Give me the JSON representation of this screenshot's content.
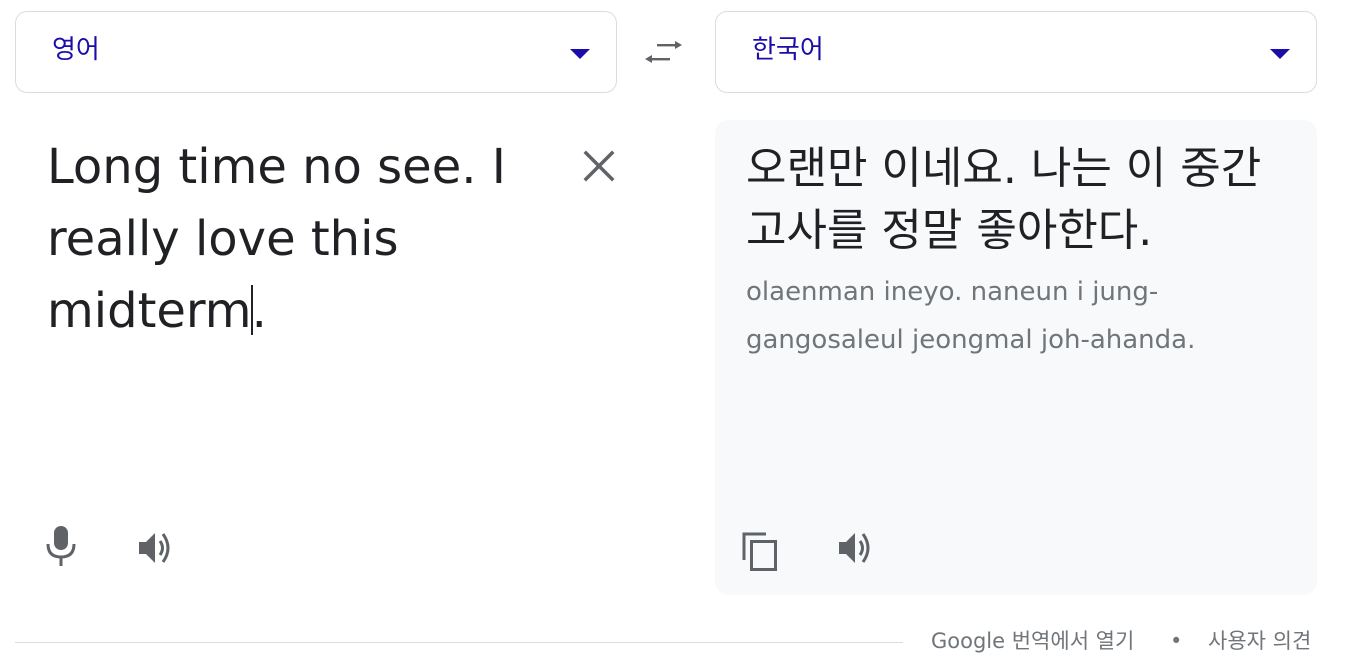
{
  "source": {
    "language": "영어",
    "text_before_cursor": "Long time no see. I really love this midterm",
    "text_after_cursor": "."
  },
  "target": {
    "language": "한국어",
    "translation": "오랜만 이네요. 나는 이 중간 고사를 정말 좋아한다.",
    "romanization": "olaenman ineyo. naneun i jung-gangosaleul jeongmal joh-ahanda."
  },
  "footer": {
    "open_in_translate": "Google 번역에서 열기",
    "separator": "•",
    "feedback": "사용자 의견"
  },
  "colors": {
    "accent": "#1a0dab",
    "icon": "#5f6368",
    "panel_bg": "#f8f9fa",
    "border": "#dadce0",
    "secondary_text": "#70757a"
  },
  "icons": {
    "swap": "swap-icon",
    "clear": "close-icon",
    "mic": "microphone-icon",
    "speaker": "speaker-icon",
    "copy": "copy-icon",
    "dropdown": "chevron-down-icon"
  }
}
